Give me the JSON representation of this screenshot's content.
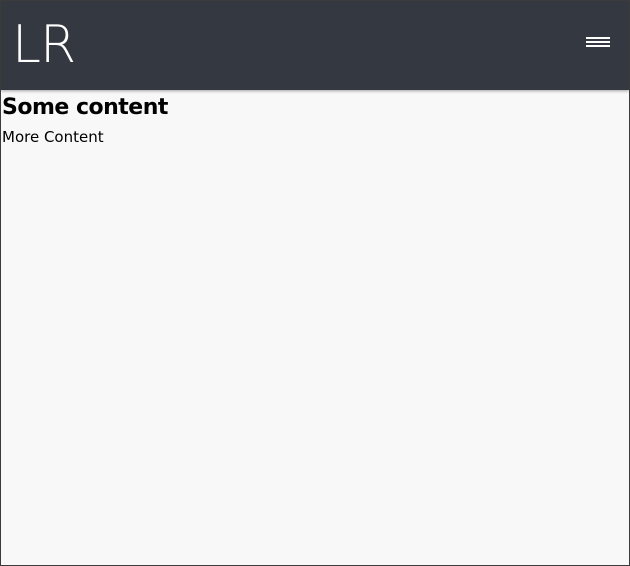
{
  "navbar": {
    "logo_text": "LR",
    "menu_icon": "hamburger-menu-icon"
  },
  "content": {
    "heading": "Some content",
    "body": "More Content"
  },
  "colors": {
    "navbar_bg": "#343840",
    "page_bg": "#f8f8f8",
    "logo_text": "#ffffff",
    "body_text": "#000000"
  }
}
